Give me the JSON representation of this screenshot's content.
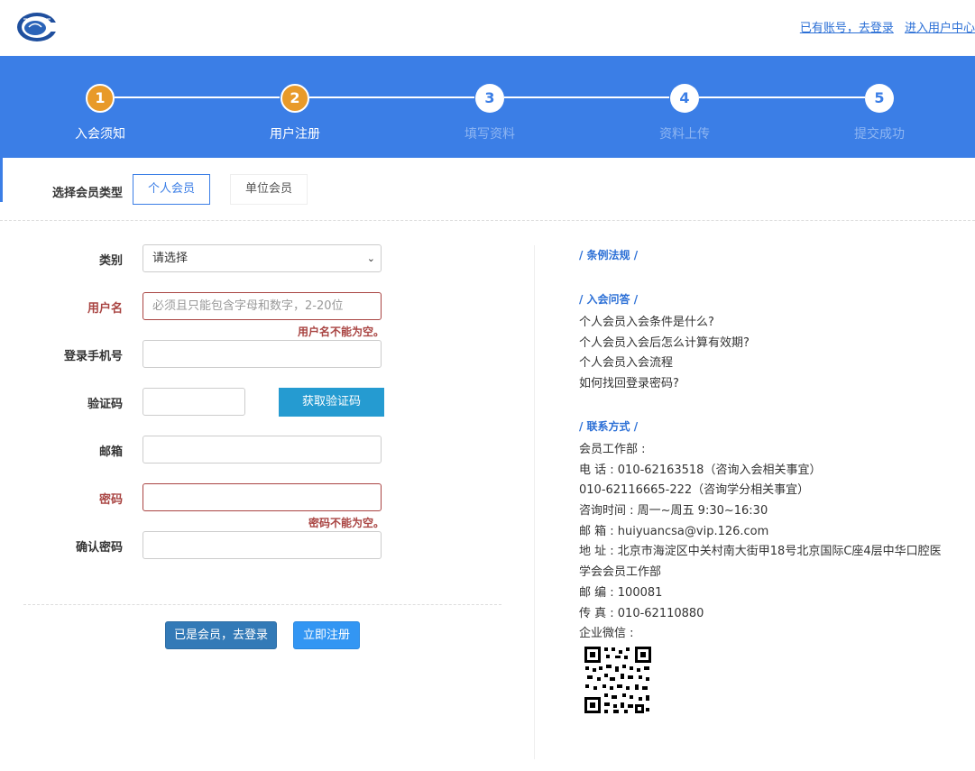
{
  "header": {
    "logo_icon": "society-logo-icon",
    "login_link": "已有账号，去登录",
    "user_center_link": "进入用户中心"
  },
  "steps": [
    {
      "num": "1",
      "label": "入会须知",
      "state": "done"
    },
    {
      "num": "2",
      "label": "用户注册",
      "state": "done"
    },
    {
      "num": "3",
      "label": "填写资料",
      "state": "todo"
    },
    {
      "num": "4",
      "label": "资料上传",
      "state": "todo"
    },
    {
      "num": "5",
      "label": "提交成功",
      "state": "todo"
    }
  ],
  "member_type": {
    "label": "选择会员类型",
    "options": [
      "个人会员",
      "单位会员"
    ],
    "selected": "个人会员"
  },
  "form": {
    "category_label": "类别",
    "category_value": "请选择",
    "username_label": "用户名",
    "username_placeholder": "必须且只能包含字母和数字，2-20位",
    "username_error": "用户名不能为空。",
    "phone_label": "登录手机号",
    "code_label": "验证码",
    "code_button": "获取验证码",
    "email_label": "邮箱",
    "password_label": "密码",
    "password_error": "密码不能为空。",
    "confirm_label": "确认密码",
    "login_button": "已是会员，去登录",
    "register_button": "立即注册"
  },
  "sidebar": {
    "rules_heading": "/ 条例法规 /",
    "faq_heading": "/ 入会问答 /",
    "faq_items": [
      "个人会员入会条件是什么?",
      "个人会员入会后怎么计算有效期?",
      "个人会员入会流程",
      "如何找回登录密码?"
    ],
    "contact_heading": "/ 联系方式 /",
    "contact_lines": [
      "会员工作部 :",
      "电 话 : 010-62163518（咨询入会相关事宜）",
      "010-62116665-222（咨询学分相关事宜）",
      "咨询时间 : 周一~周五 9:30~16:30",
      "邮 箱 : huiyuancsa@vip.126.com",
      "地 址 : 北京市海淀区中关村南大街甲18号北京国际C座4层中华口腔医",
      "学会会员工作部",
      "邮 编 : 100081",
      "传 真 : 010-62110880",
      "企业微信 :"
    ],
    "qr_icon": "wechat-qr-code-icon"
  },
  "colors": {
    "primary": "#3b7ee6",
    "step_done": "#e89a2a",
    "error": "#a94442",
    "code_button": "#259bd1"
  }
}
